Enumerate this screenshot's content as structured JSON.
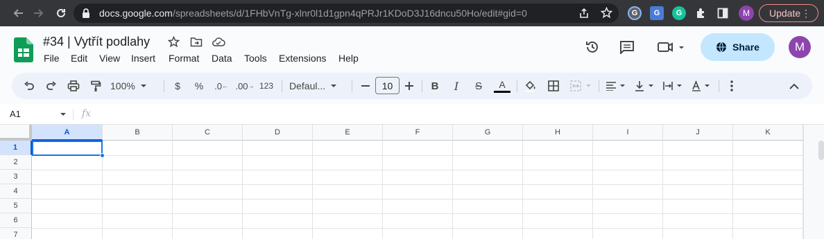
{
  "browser": {
    "url_host": "docs.google.com",
    "url_path": "/spreadsheets/d/1FHbVnTg-xlnr0l1d1gpn4qPRJr1KDoD3J16dncu50Ho/edit#gid=0",
    "update_label": "Update",
    "profile_initial": "M"
  },
  "doc": {
    "title": "#34 | Vytřít podlahy"
  },
  "menu": [
    "File",
    "Edit",
    "View",
    "Insert",
    "Format",
    "Data",
    "Tools",
    "Extensions",
    "Help"
  ],
  "header": {
    "share_label": "Share",
    "avatar_initial": "M"
  },
  "toolbar": {
    "zoom": "100%",
    "currency": "$",
    "percent": "%",
    "decrease_decimal": ".0",
    "increase_decimal": ".00",
    "more_formats": "123",
    "font": "Defaul...",
    "font_size": "10"
  },
  "formula_bar": {
    "name_box": "A1",
    "fx": "fx"
  },
  "grid": {
    "columns": [
      "A",
      "B",
      "C",
      "D",
      "E",
      "F",
      "G",
      "H",
      "I",
      "J",
      "K"
    ],
    "rows": [
      "1",
      "2",
      "3",
      "4",
      "5",
      "6",
      "7"
    ],
    "selected_cell": "A1"
  },
  "colors": {
    "chrome_bg": "#35363a",
    "share_bg": "#c2e7ff",
    "selection": "#1a73e8",
    "sheets_green": "#0f9d58"
  }
}
